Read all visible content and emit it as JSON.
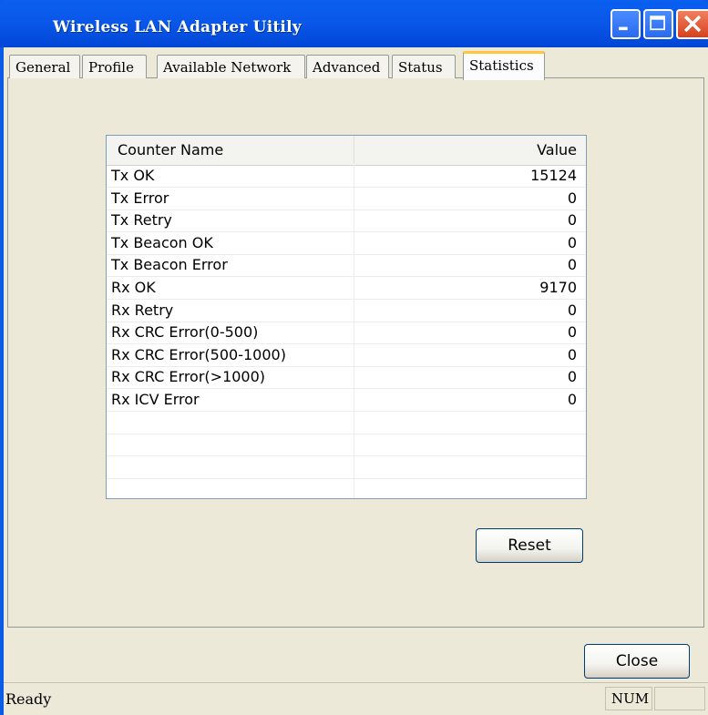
{
  "window": {
    "title": "Wireless LAN Adapter Uitily"
  },
  "tabs": [
    {
      "label": "General"
    },
    {
      "label": "Profile"
    },
    {
      "label": "Available Network"
    },
    {
      "label": "Advanced"
    },
    {
      "label": "Status"
    },
    {
      "label": "Statistics"
    }
  ],
  "active_tab": "Statistics",
  "statistics": {
    "columns": {
      "name": "Counter Name",
      "value": "Value"
    },
    "rows": [
      {
        "name": "Tx OK",
        "value": "15124"
      },
      {
        "name": "Tx Error",
        "value": "0"
      },
      {
        "name": "Tx Retry",
        "value": "0"
      },
      {
        "name": "Tx Beacon OK",
        "value": "0"
      },
      {
        "name": "Tx Beacon Error",
        "value": "0"
      },
      {
        "name": "Rx OK",
        "value": "9170"
      },
      {
        "name": "Rx Retry",
        "value": "0"
      },
      {
        "name": "Rx CRC Error(0-500)",
        "value": "0"
      },
      {
        "name": "Rx CRC Error(500-1000)",
        "value": "0"
      },
      {
        "name": "Rx CRC Error(>1000)",
        "value": "0"
      },
      {
        "name": "Rx ICV Error",
        "value": "0"
      }
    ],
    "reset_label": "Reset"
  },
  "footer": {
    "close_label": "Close"
  },
  "statusbar": {
    "text": "Ready",
    "num_indicator": "NUM"
  },
  "colors": {
    "titlebar": "#0a56e8",
    "active_tab_accent": "#ffc83c",
    "dialog_bg": "#ece9d8"
  }
}
